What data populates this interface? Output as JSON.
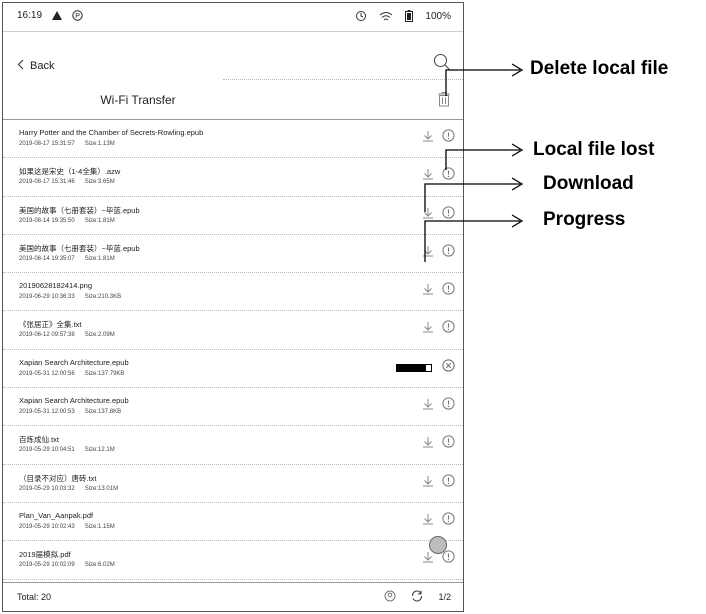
{
  "status_bar": {
    "time": "16:19",
    "left_icons": [
      "warning-triangle-icon",
      "p-notification-icon"
    ],
    "battery": "100%"
  },
  "header": {
    "back_label": "Back",
    "title": "Wi-Fi Transfer"
  },
  "files": [
    {
      "name": "Harry Potter and the Chamber of Secrets-Rowling.epub",
      "date": "2019-08-17 15:31:57",
      "size": "Size:1.13M"
    },
    {
      "name": "如果这是宋史（1-4全集）.azw",
      "date": "2019-08-17 15:31:46",
      "size": "Size:3.65M"
    },
    {
      "name": "美国的故事（七册套装）~毕蓝.epub",
      "date": "2019-08-14 19:35:50",
      "size": "Size:1.81M"
    },
    {
      "name": "美国的故事（七册套装）~毕蓝.epub",
      "date": "2019-08-14 19:35:07",
      "size": "Size:1.81M"
    },
    {
      "name": "20190628182414.png",
      "date": "2019-06-29 10:36:33",
      "size": "Size:210.3KB"
    },
    {
      "name": "《张居正》全集.txt",
      "date": "2019-06-12 09:57:38",
      "size": "Size:2.09M"
    },
    {
      "name": "Xapian Search Architecture.epub",
      "date": "2019-05-31 12:00:56",
      "size": "Size:137.79KB",
      "progress": 0.85
    },
    {
      "name": "Xapian Search Architecture.epub",
      "date": "2019-05-31 12:00:53",
      "size": "Size:137.8KB"
    },
    {
      "name": "百炼成仙.txt",
      "date": "2019-05-29 10:04:51",
      "size": "Size:12.1M"
    },
    {
      "name": "（目录不对应）唐砖.txt",
      "date": "2019-05-29 10:03:32",
      "size": "Size:13.01M"
    },
    {
      "name": "Plan_Van_Aanpak.pdf",
      "date": "2019-05-29 10:02:43",
      "size": "Size:1.15M"
    },
    {
      "name": "2019届模拟.pdf",
      "date": "2019-05-29 10:02:09",
      "size": "Size:6.02M"
    }
  ],
  "footer": {
    "total": "Total: 20",
    "page": "1/2"
  },
  "callouts": {
    "delete": "Delete local file",
    "lost": "Local file lost",
    "download": "Download",
    "progress": "Progress"
  }
}
